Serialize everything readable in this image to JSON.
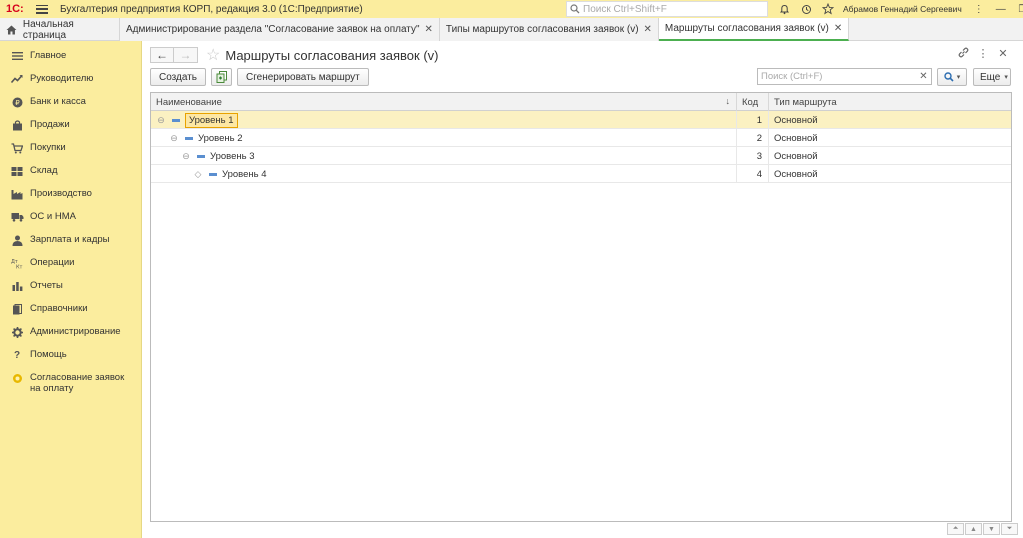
{
  "titlebar": {
    "logo": "1С:",
    "app_title": "Бухгалтерия предприятия КОРП, редакция 3.0  (1С:Предприятие)",
    "search_placeholder": "Поиск Ctrl+Shift+F",
    "username": "Абрамов Геннадий Сергеевич"
  },
  "tabs": {
    "home": "Начальная страница",
    "items": [
      {
        "label": "Администрирование раздела \"Согласование заявок на оплату\""
      },
      {
        "label": "Типы маршрутов согласования заявок (v)"
      },
      {
        "label": "Маршруты согласования заявок (v)"
      }
    ]
  },
  "sidebar": {
    "items": [
      {
        "label": "Главное",
        "icon": "menu-lines-icon"
      },
      {
        "label": "Руководителю",
        "icon": "trend-icon"
      },
      {
        "label": "Банк и касса",
        "icon": "coin-icon"
      },
      {
        "label": "Продажи",
        "icon": "bag-icon"
      },
      {
        "label": "Покупки",
        "icon": "cart-icon"
      },
      {
        "label": "Склад",
        "icon": "warehouse-icon"
      },
      {
        "label": "Производство",
        "icon": "factory-icon"
      },
      {
        "label": "ОС и НМА",
        "icon": "truck-icon"
      },
      {
        "label": "Зарплата и кадры",
        "icon": "person-icon"
      },
      {
        "label": "Операции",
        "icon": "dt-kt-icon"
      },
      {
        "label": "Отчеты",
        "icon": "bar-chart-icon"
      },
      {
        "label": "Справочники",
        "icon": "books-icon"
      },
      {
        "label": "Администрирование",
        "icon": "gear-icon"
      },
      {
        "label": "Помощь",
        "icon": "question-icon"
      },
      {
        "label": "Согласование заявок на оплату",
        "icon": "approval-icon"
      }
    ]
  },
  "form": {
    "title": "Маршруты согласования заявок (v)",
    "create_label": "Создать",
    "generate_label": "Сгенерировать маршрут",
    "search_placeholder": "Поиск (Ctrl+F)",
    "more_label": "Еще",
    "more_arrow": "▾"
  },
  "table": {
    "headers": {
      "name": "Наименование",
      "code": "Код",
      "type": "Тип маршрута"
    },
    "rows": [
      {
        "name": "Уровень 1",
        "code": "1",
        "type": "Основной",
        "level": 0
      },
      {
        "name": "Уровень 2",
        "code": "2",
        "type": "Основной",
        "level": 1
      },
      {
        "name": "Уровень 3",
        "code": "3",
        "type": "Основной",
        "level": 2
      },
      {
        "name": "Уровень 4",
        "code": "4",
        "type": "Основной",
        "level": 3
      }
    ]
  },
  "colors": {
    "sidebar_bg": "#fbed9e",
    "selected_row": "#fbf1c2",
    "active_tab_underline": "#4caf50"
  }
}
